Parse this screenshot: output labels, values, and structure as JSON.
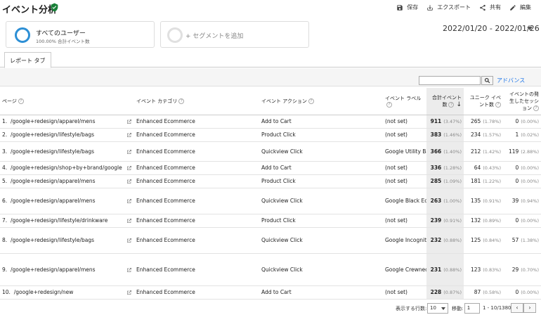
{
  "header": {
    "title": "イベント分析",
    "actions": {
      "save": "保存",
      "export": "エクスポート",
      "share": "共有",
      "edit": "編集"
    }
  },
  "segments": {
    "primary": {
      "name": "すべてのユーザー",
      "sub": "100.00% 合計イベント数",
      "color": "#2d8fd5"
    },
    "add": "+ セグメントを追加"
  },
  "date_range": "2022/01/20 - 2022/01/26",
  "tabs": [
    {
      "label": "レポート タブ"
    }
  ],
  "toolbar": {
    "search_placeholder": "",
    "advanced": "アドバンス"
  },
  "columns": {
    "page": "ページ",
    "category": "イベント カテゴリ",
    "action": "イベント アクション",
    "label": "イベント ラベル",
    "total_events": "合計イベント数",
    "unique_events": "ユニーク イベント数",
    "sessions": "イベントの発生したセッション"
  },
  "rows": [
    {
      "n": "1.",
      "page": "/google+redesign/apparel/mens",
      "category": "Enhanced Ecommerce",
      "action": "Add to Cart",
      "label": "(not set)",
      "total": "911",
      "total_pct": "(3.47%)",
      "unique": "265",
      "unique_pct": "(1.78%)",
      "sessions": "0",
      "sessions_pct": "(0.00%)"
    },
    {
      "n": "2.",
      "page": "/google+redesign/lifestyle/bags",
      "category": "Enhanced Ecommerce",
      "action": "Product Click",
      "label": "(not set)",
      "total": "383",
      "total_pct": "(1.46%)",
      "unique": "234",
      "unique_pct": "(1.57%)",
      "sessions": "1",
      "sessions_pct": "(0.02%)"
    },
    {
      "n": "3.",
      "page": "/google+redesign/lifestyle/bags",
      "category": "Enhanced Ecommerce",
      "action": "Quickview Click",
      "label": "Google Utility BackPack",
      "total": "366",
      "total_pct": "(1.40%)",
      "unique": "212",
      "unique_pct": "(1.42%)",
      "sessions": "119",
      "sessions_pct": "(2.88%)"
    },
    {
      "n": "4.",
      "page": "/google+redesign/shop+by+brand/google",
      "category": "Enhanced Ecommerce",
      "action": "Add to Cart",
      "label": "(not set)",
      "total": "336",
      "total_pct": "(1.28%)",
      "unique": "64",
      "unique_pct": "(0.43%)",
      "sessions": "0",
      "sessions_pct": "(0.00%)"
    },
    {
      "n": "5.",
      "page": "/google+redesign/apparel/mens",
      "category": "Enhanced Ecommerce",
      "action": "Product Click",
      "label": "(not set)",
      "total": "285",
      "total_pct": "(1.09%)",
      "unique": "181",
      "unique_pct": "(1.22%)",
      "sessions": "0",
      "sessions_pct": "(0.00%)"
    },
    {
      "n": "6.",
      "page": "/google+redesign/apparel/mens",
      "category": "Enhanced Ecommerce",
      "action": "Quickview Click",
      "label": "Google Black Eco Zip Hoodie",
      "total": "263",
      "total_pct": "(1.00%)",
      "unique": "135",
      "unique_pct": "(0.91%)",
      "sessions": "39",
      "sessions_pct": "(0.94%)"
    },
    {
      "n": "7.",
      "page": "/google+redesign/lifestyle/drinkware",
      "category": "Enhanced Ecommerce",
      "action": "Product Click",
      "label": "(not set)",
      "total": "239",
      "total_pct": "(0.91%)",
      "unique": "132",
      "unique_pct": "(0.89%)",
      "sessions": "0",
      "sessions_pct": "(0.00%)"
    },
    {
      "n": "8.",
      "page": "/google+redesign/lifestyle/bags",
      "category": "Enhanced Ecommerce",
      "action": "Quickview Click",
      "label": "Google Incognito Techpack V2",
      "total": "232",
      "total_pct": "(0.88%)",
      "unique": "125",
      "unique_pct": "(0.84%)",
      "sessions": "57",
      "sessions_pct": "(1.38%)"
    },
    {
      "n": "9.",
      "page": "/google+redesign/apparel/mens",
      "category": "Enhanced Ecommerce",
      "action": "Quickview Click",
      "label": "Google Crewneck Sweatshirt Black",
      "total": "231",
      "total_pct": "(0.88%)",
      "unique": "123",
      "unique_pct": "(0.83%)",
      "sessions": "29",
      "sessions_pct": "(0.70%)"
    },
    {
      "n": "10.",
      "page": "/google+redesign/new",
      "category": "Enhanced Ecommerce",
      "action": "Add to Cart",
      "label": "(not set)",
      "total": "228",
      "total_pct": "(0.87%)",
      "unique": "87",
      "unique_pct": "(0.58%)",
      "sessions": "0",
      "sessions_pct": "(0.00%)"
    }
  ],
  "footer": {
    "show_rows": "表示する行数:",
    "rows_value": "10",
    "move": "移動:",
    "page_value": "1",
    "range": "1 - 10/1380"
  }
}
